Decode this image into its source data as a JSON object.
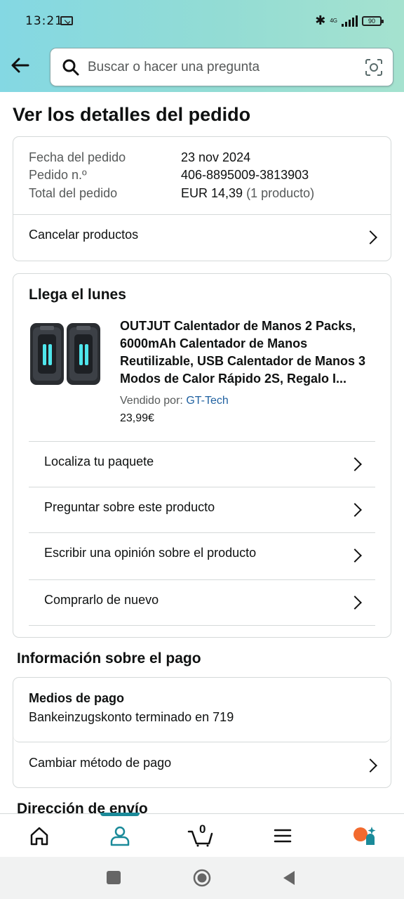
{
  "status": {
    "time": "13:21",
    "network": "4G",
    "battery": "90"
  },
  "search": {
    "placeholder": "Buscar o hacer una pregunta"
  },
  "page": {
    "title": "Ver los detalles del pedido"
  },
  "order": {
    "date_label": "Fecha del pedido",
    "date_value": "23 nov 2024",
    "number_label": "Pedido n.º",
    "number_value": "406-8895009-3813903",
    "total_label": "Total del pedido",
    "total_value": "EUR 14,39",
    "total_note": "(1 producto)",
    "cancel_label": "Cancelar productos"
  },
  "shipment": {
    "heading": "Llega el lunes",
    "product_title": "OUTJUT Calentador de Manos 2 Packs, 6000mAh Calentador de Manos Reutilizable, USB Calentador de Manos 3 Modos de Calor Rápido 2S, Regalo I...",
    "seller_label": "Vendido por:",
    "seller_name": "GT-Tech",
    "price": "23,99€",
    "actions": [
      {
        "label": "Localiza tu paquete"
      },
      {
        "label": "Preguntar sobre este producto"
      },
      {
        "label": "Escribir una opinión sobre el producto"
      },
      {
        "label": "Comprarlo de nuevo"
      }
    ]
  },
  "payment": {
    "heading": "Información sobre el pago",
    "method_label": "Medios de pago",
    "method_value": "Bankeinzugskonto terminado en 719",
    "change_label": "Cambiar método de pago"
  },
  "shipping": {
    "heading": "Dirección de envío"
  },
  "bottom_nav": {
    "cart_count": "0"
  },
  "colors": {
    "accent": "#1a8a99",
    "link": "#2162a1",
    "header_start": "#84d8e3",
    "header_end": "#a5e2cf"
  }
}
